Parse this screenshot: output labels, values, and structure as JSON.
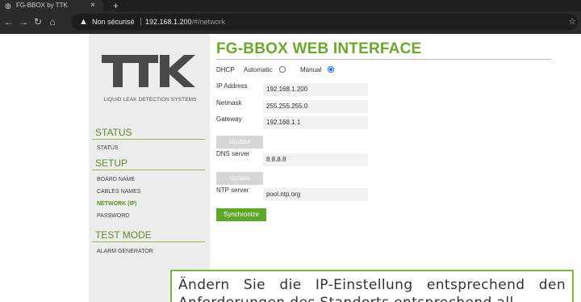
{
  "browser": {
    "tab_title": "FG-BBOX by TTK",
    "tab_close": "×",
    "new_tab": "+",
    "security_label": "Non sécurisé",
    "url_host": "192.168.1.200",
    "url_path": "/#/network",
    "icons": {
      "back": "arrow-left",
      "forward": "arrow-right",
      "reload": "reload",
      "home": "home",
      "warning": "warning-triangle",
      "bookmark": "star"
    }
  },
  "sidebar": {
    "logo_text": "TTK",
    "tagline": "LIQUID LEAK DETECTION SYSTEMS",
    "sections": [
      {
        "title": "STATUS",
        "items": [
          {
            "label": "STATUS",
            "active": false
          }
        ]
      },
      {
        "title": "SETUP",
        "items": [
          {
            "label": "BOARD NAME",
            "active": false
          },
          {
            "label": "CABLES NAMES",
            "active": false
          },
          {
            "label": "NETWORK (IP)",
            "active": true
          },
          {
            "label": "PASSWORD",
            "active": false
          }
        ]
      },
      {
        "title": "TEST MODE",
        "items": [
          {
            "label": "ALARM GENERATOR",
            "active": false
          }
        ]
      }
    ]
  },
  "main": {
    "title": "FG-BBOX WEB INTERFACE",
    "dhcp": {
      "label": "DHCP",
      "options": [
        "Automatic",
        "Manual"
      ],
      "selected": "Manual"
    },
    "ip_address": {
      "label": "IP Address",
      "value": "192.168.1.200"
    },
    "netmask": {
      "label": "Netmask",
      "value": "255.255.255.0"
    },
    "gateway": {
      "label": "Gateway",
      "value": "192.168.1.1"
    },
    "update_label": "Update",
    "dns": {
      "label": "DNS server",
      "value": "8.8.8.8"
    },
    "ntp": {
      "label": "NTP server",
      "value": "pool.ntp.org"
    },
    "synchronize_label": "Synchronize"
  },
  "caption": {
    "text": "Ändern Sie die IP-Einstellung entsprechend den Anforderungen des Standorts entsprechend all"
  },
  "colors": {
    "accent_green": "#6aa92b",
    "radio_blue": "#1a73e8",
    "chrome_dark": "#2b2b2b"
  }
}
